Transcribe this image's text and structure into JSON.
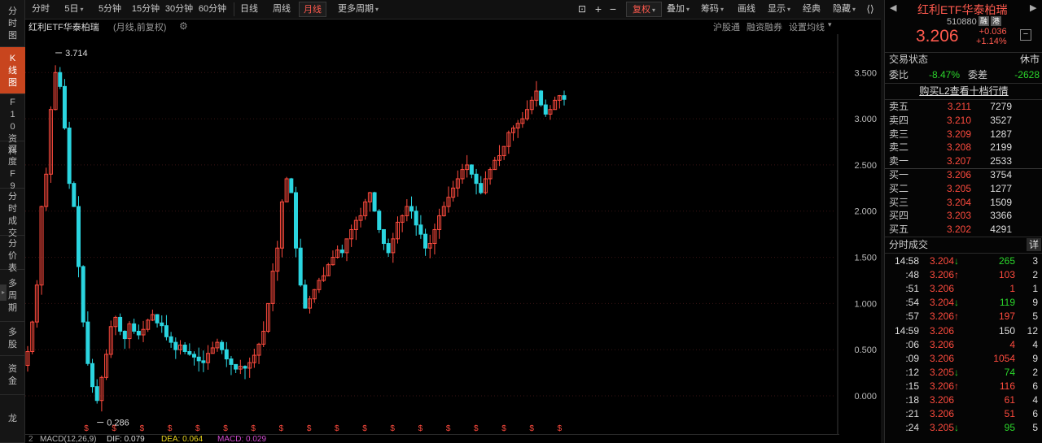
{
  "left_tabs": [
    {
      "label": "分时图"
    },
    {
      "label": "K线图",
      "active": true
    },
    {
      "label": "F10资料"
    },
    {
      "label": "深度F9"
    },
    {
      "label": "分时成交"
    },
    {
      "label": "分价表"
    },
    {
      "label": "多周期"
    },
    {
      "label": "多股"
    },
    {
      "label": "资金"
    },
    {
      "label": "龙"
    }
  ],
  "toolbar": {
    "periods": [
      "分时",
      "5日",
      "5分钟",
      "15分钟",
      "30分钟",
      "60分钟",
      "日线",
      "周线",
      "月线",
      "更多周期"
    ],
    "active_period": "月线",
    "rights_label": "复权",
    "overlay_label": "叠加",
    "chips_label": "筹码",
    "drawline_label": "画线",
    "display_label": "显示",
    "classic_label": "经典",
    "hide_label": "隐藏"
  },
  "chart_info": {
    "title": "红利ETF华泰柏瑞",
    "subtitle": "(月线,前复权)",
    "controls": [
      "沪股通",
      "融资融券",
      "设置均线"
    ]
  },
  "chart_data": {
    "type": "candlestick",
    "y_ticks": [
      "3.500",
      "3.000",
      "2.500",
      "2.000",
      "1.500",
      "1.000",
      "0.500",
      "0.000"
    ],
    "ylim": [
      -0.29,
      3.74
    ],
    "max_label": "3.714",
    "min_label": "0.286",
    "dividend_marker": "$",
    "dividend_count": 18,
    "series_description": "monthly close estimated from chart",
    "closes": [
      0.48,
      0.8,
      1.2,
      2.05,
      2.4,
      3.1,
      3.5,
      3.35,
      2.9,
      2.3,
      2.05,
      1.4,
      0.8,
      0.35,
      0.1,
      -0.05,
      0.2,
      0.45,
      0.75,
      0.85,
      0.7,
      0.62,
      0.78,
      0.7,
      0.66,
      0.72,
      0.82,
      0.88,
      0.79,
      0.76,
      0.64,
      0.58,
      0.5,
      0.55,
      0.48,
      0.45,
      0.42,
      0.38,
      0.36,
      0.46,
      0.52,
      0.58,
      0.5,
      0.4,
      0.34,
      0.29,
      0.32,
      0.3,
      0.36,
      0.44,
      0.56,
      0.7,
      1.0,
      1.35,
      1.6,
      2.1,
      2.35,
      2.2,
      1.6,
      1.2,
      0.95,
      1.05,
      1.15,
      1.25,
      1.3,
      1.42,
      1.5,
      1.58,
      1.55,
      1.7,
      1.8,
      1.9,
      1.95,
      2.1,
      2.2,
      2.0,
      1.8,
      1.65,
      1.55,
      1.7,
      1.88,
      1.95,
      2.05,
      2.0,
      1.85,
      1.75,
      1.6,
      1.65,
      1.8,
      1.95,
      2.05,
      2.15,
      2.25,
      2.35,
      2.45,
      2.5,
      2.4,
      2.3,
      2.2,
      2.35,
      2.45,
      2.55,
      2.6,
      2.7,
      2.85,
      2.9,
      2.95,
      3.0,
      3.1,
      3.2,
      3.3,
      3.15,
      3.05,
      3.1,
      3.2,
      3.25,
      3.21
    ]
  },
  "macd": {
    "params": "MACD(12,26,9)",
    "dif": "DIF: 0.079",
    "dea": "DEA: 0.064",
    "macd": "MACD: 0.029"
  },
  "stock": {
    "name": "红利ETF华泰柏瑞",
    "code": "510880",
    "badge1": "融",
    "badge2": "港",
    "price": "3.206",
    "change": "+0.036",
    "change_pct": "+1.14%"
  },
  "status": {
    "label": "交易状态",
    "value": "休市",
    "ratio_label": "委比",
    "ratio_value": "-8.47%",
    "diff_label": "委差",
    "diff_value": "-2628"
  },
  "l2_link": "购买L2查看十档行情",
  "order_book": {
    "asks": [
      {
        "label": "卖五",
        "price": "3.211",
        "vol": "7279"
      },
      {
        "label": "卖四",
        "price": "3.210",
        "vol": "3527"
      },
      {
        "label": "卖三",
        "price": "3.209",
        "vol": "1287"
      },
      {
        "label": "卖二",
        "price": "3.208",
        "vol": "2199"
      },
      {
        "label": "卖一",
        "price": "3.207",
        "vol": "2533"
      }
    ],
    "bids": [
      {
        "label": "买一",
        "price": "3.206",
        "vol": "3754"
      },
      {
        "label": "买二",
        "price": "3.205",
        "vol": "1277"
      },
      {
        "label": "买三",
        "price": "3.204",
        "vol": "1509"
      },
      {
        "label": "买四",
        "price": "3.203",
        "vol": "3366"
      },
      {
        "label": "买五",
        "price": "3.202",
        "vol": "4291"
      }
    ]
  },
  "trades_header": {
    "label": "分时成交",
    "detail": "详"
  },
  "trades": [
    {
      "time": "14:58",
      "price": "3.204",
      "dir": "down",
      "vol": "265",
      "n": "3",
      "vcolor": "green"
    },
    {
      "time": ":48",
      "price": "3.206",
      "dir": "up",
      "vol": "103",
      "n": "2",
      "vcolor": "red"
    },
    {
      "time": ":51",
      "price": "3.206",
      "dir": "",
      "vol": "1",
      "n": "1",
      "vcolor": "red"
    },
    {
      "time": ":54",
      "price": "3.204",
      "dir": "down",
      "vol": "119",
      "n": "9",
      "vcolor": "green"
    },
    {
      "time": ":57",
      "price": "3.206",
      "dir": "up",
      "vol": "197",
      "n": "5",
      "vcolor": "red"
    },
    {
      "time": "14:59",
      "price": "3.206",
      "dir": "",
      "vol": "150",
      "n": "12",
      "vcolor": "white"
    },
    {
      "time": ":06",
      "price": "3.206",
      "dir": "",
      "vol": "4",
      "n": "4",
      "vcolor": "red"
    },
    {
      "time": ":09",
      "price": "3.206",
      "dir": "",
      "vol": "1054",
      "n": "9",
      "vcolor": "red"
    },
    {
      "time": ":12",
      "price": "3.205",
      "dir": "down",
      "vol": "74",
      "n": "2",
      "vcolor": "green"
    },
    {
      "time": ":15",
      "price": "3.206",
      "dir": "up",
      "vol": "116",
      "n": "6",
      "vcolor": "red"
    },
    {
      "time": ":18",
      "price": "3.206",
      "dir": "",
      "vol": "61",
      "n": "4",
      "vcolor": "red"
    },
    {
      "time": ":21",
      "price": "3.206",
      "dir": "",
      "vol": "51",
      "n": "6",
      "vcolor": "red"
    },
    {
      "time": ":24",
      "price": "3.205",
      "dir": "down",
      "vol": "95",
      "n": "5",
      "vcolor": "green"
    }
  ],
  "colors": {
    "up": "#ff4b3e",
    "down": "#2bd5e0",
    "accent": "#c8451e"
  }
}
